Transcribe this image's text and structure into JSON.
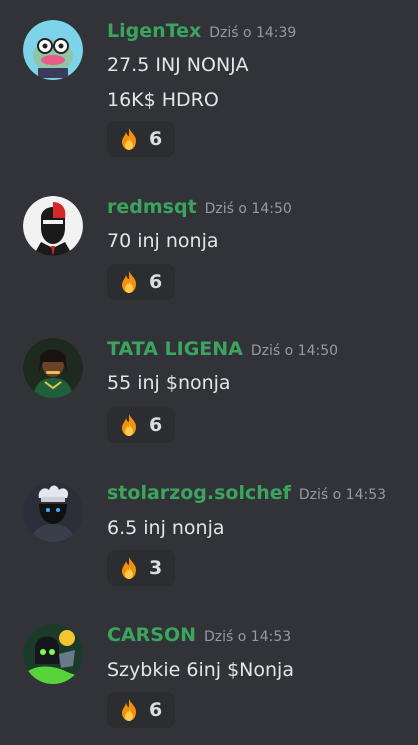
{
  "messages": [
    {
      "username": "LigenTex",
      "timestamp": "Dziś o 14:39",
      "lines": [
        "27.5 INJ  NONJA",
        "16K$ HDRO"
      ],
      "reaction": {
        "emoji": "fire-emoji",
        "count": "6"
      }
    },
    {
      "username": "redmsqt",
      "timestamp": "Dziś o 14:50",
      "lines": [
        "70 inj nonja"
      ],
      "reaction": {
        "emoji": "fire-emoji",
        "count": "6"
      }
    },
    {
      "username": "TATA LIGENA",
      "timestamp": "Dziś o 14:50",
      "lines": [
        "55 inj $nonja"
      ],
      "reaction": {
        "emoji": "fire-emoji",
        "count": "6"
      }
    },
    {
      "username": "stolarzog.solchef",
      "timestamp": "Dziś o 14:53",
      "lines": [
        "6.5 inj nonja"
      ],
      "reaction": {
        "emoji": "fire-emoji",
        "count": "3"
      }
    },
    {
      "username": "CARSON",
      "timestamp": "Dziś o 14:53",
      "lines": [
        "Szybkie 6inj $Nonja"
      ],
      "reaction": {
        "emoji": "fire-emoji",
        "count": "6"
      }
    }
  ],
  "colors": {
    "background": "#313338",
    "username": "#3ba55d",
    "timestamp": "#949ba4",
    "reaction_bg": "#2b2d31"
  }
}
